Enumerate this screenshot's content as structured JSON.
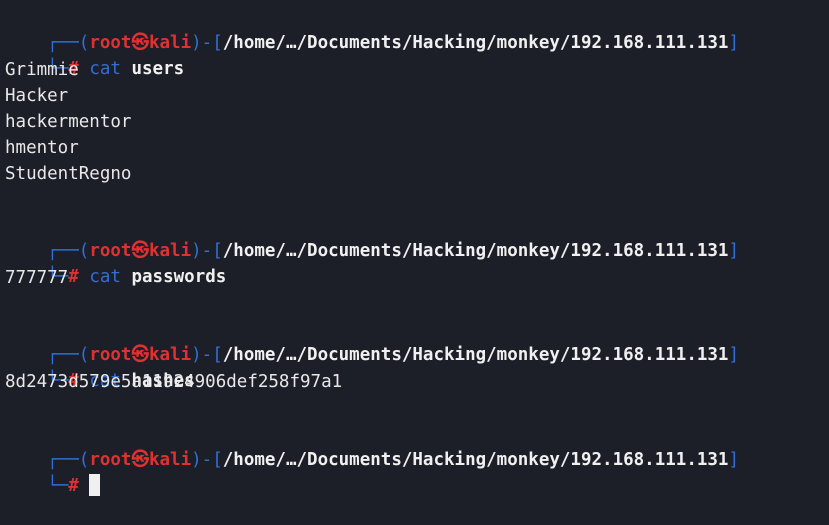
{
  "prompt": {
    "corner_top": "┌──",
    "corner_bottom": "└─",
    "lparen": "(",
    "user": "root",
    "at_symbol": "㉿",
    "host": "kali",
    "rparen": ")",
    "dash_bracket_open": "-[",
    "path": "/home/…/Documents/Hacking/monkey/192.168.111.131",
    "bracket_close": "]",
    "hash": "#"
  },
  "blocks": [
    {
      "command": "cat",
      "argument": "users",
      "output": [
        "Grimmie",
        "Hacker",
        "hackermentor",
        "hmentor",
        "StudentRegno"
      ]
    },
    {
      "command": "cat",
      "argument": "passwords",
      "output": [
        "777777"
      ]
    },
    {
      "command": "cat",
      "argument": "hashes",
      "output": [
        "8d2473d579e5a11924906def258f97a1"
      ]
    }
  ],
  "colors": {
    "background": "#1d1f28",
    "prompt_frame": "#2f6fd6",
    "user_host": "#e03131",
    "text": "#e8e8e8"
  }
}
